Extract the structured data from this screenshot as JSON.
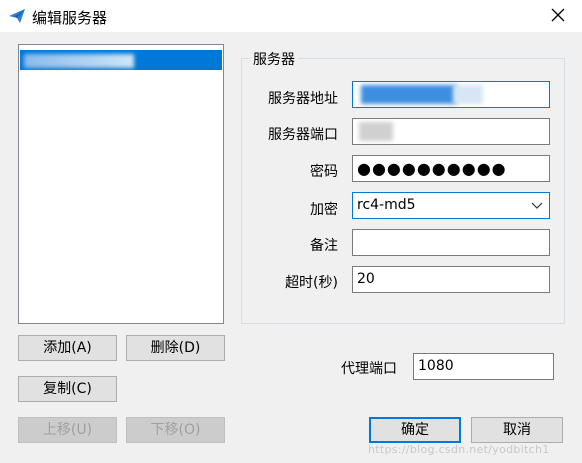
{
  "window": {
    "title": "编辑服务器"
  },
  "left_buttons": {
    "add": "添加(A)",
    "delete": "删除(D)",
    "copy": "复制(C)",
    "move_up": "上移(U)",
    "move_down": "下移(O)"
  },
  "group": {
    "title": "服务器",
    "server_address_label": "服务器地址",
    "server_port_label": "服务器端口",
    "password_label": "密码",
    "password_value": "●●●●●●●●●●",
    "encryption_label": "加密",
    "encryption_value": "rc4-md5",
    "remarks_label": "备注",
    "remarks_value": "",
    "timeout_label": "超时(秒)",
    "timeout_value": "20"
  },
  "proxy": {
    "label": "代理端口",
    "value": "1080"
  },
  "footer_buttons": {
    "ok": "确定",
    "cancel": "取消"
  },
  "watermark": "https://blog.csdn.net/yodbitch1",
  "colors": {
    "accent": "#0078d7",
    "selection": "#0078d7"
  },
  "icons": {
    "app": "paper-plane-icon",
    "close": "close-icon",
    "dropdown": "chevron-down-icon"
  }
}
